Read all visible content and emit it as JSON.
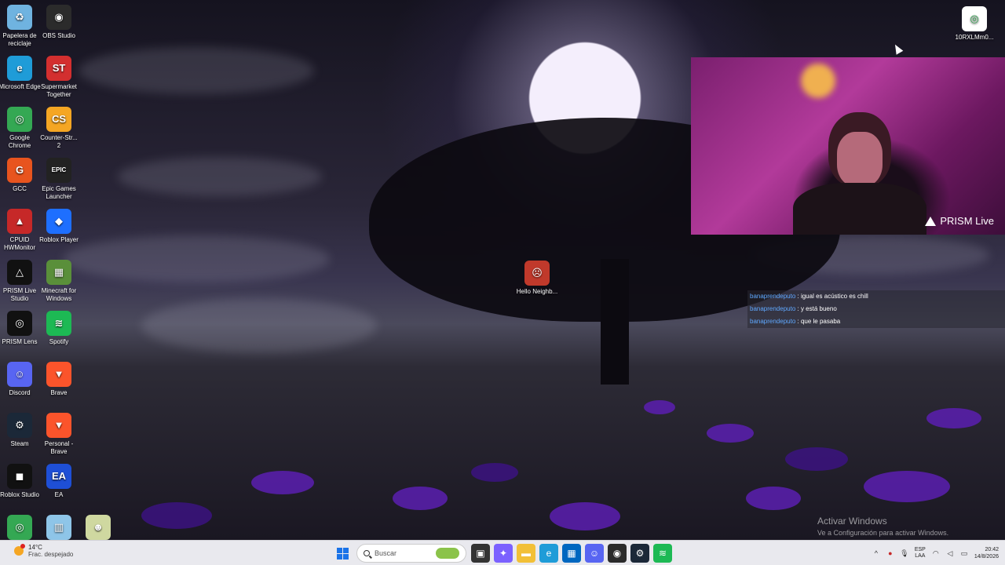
{
  "desktop_icons": [
    {
      "label": "Papelera de reciclaje",
      "icon": "recycle-bin-icon",
      "color": "#6fb3e0",
      "glyph": "♻"
    },
    {
      "label": "OBS Studio",
      "icon": "obs-icon",
      "color": "#2b2b2b",
      "glyph": "◉"
    },
    {
      "label": "Microsoft Edge",
      "icon": "edge-icon",
      "color": "#1f9cd8",
      "glyph": "e"
    },
    {
      "label": "Supermarket Together",
      "icon": "supermarket-together-icon",
      "color": "#d32f2f",
      "glyph": "ST"
    },
    {
      "label": "Google Chrome",
      "icon": "chrome-icon",
      "color": "#34a853",
      "glyph": "◎"
    },
    {
      "label": "Counter-Str... 2",
      "icon": "counter-strike-icon",
      "color": "#f5a623",
      "glyph": "CS"
    },
    {
      "label": "GCC",
      "icon": "gcc-icon",
      "color": "#e8541e",
      "glyph": "G"
    },
    {
      "label": "Epic Games Launcher",
      "icon": "epic-games-icon",
      "color": "#222222",
      "glyph": "EPIC"
    },
    {
      "label": "CPUID HWMonitor",
      "icon": "hwmonitor-icon",
      "color": "#c62828",
      "glyph": "▲"
    },
    {
      "label": "Roblox Player",
      "icon": "roblox-player-icon",
      "color": "#1e6fff",
      "glyph": "◆"
    },
    {
      "label": "PRISM Live Studio",
      "icon": "prism-live-icon",
      "color": "#111111",
      "glyph": "△"
    },
    {
      "label": "Minecraft for Windows",
      "icon": "minecraft-icon",
      "color": "#5a8f3a",
      "glyph": "▦"
    },
    {
      "label": "PRISM Lens",
      "icon": "prism-lens-icon",
      "color": "#111111",
      "glyph": "◎"
    },
    {
      "label": "Spotify",
      "icon": "spotify-icon",
      "color": "#1db954",
      "glyph": "≋"
    },
    {
      "label": "Discord",
      "icon": "discord-icon",
      "color": "#5865f2",
      "glyph": "☺"
    },
    {
      "label": "Brave",
      "icon": "brave-icon",
      "color": "#fb542b",
      "glyph": "▼"
    },
    {
      "label": "Steam",
      "icon": "steam-icon",
      "color": "#1b2838",
      "glyph": "⚙"
    },
    {
      "label": "Personal - Brave",
      "icon": "personal-brave-icon",
      "color": "#fb542b",
      "glyph": "▼"
    },
    {
      "label": "Roblox Studio",
      "icon": "roblox-studio-icon",
      "color": "#111111",
      "glyph": "◼"
    },
    {
      "label": "EA",
      "icon": "ea-icon",
      "color": "#1e4fd6",
      "glyph": "EA"
    },
    {
      "label": "",
      "icon": "chrome-icon",
      "color": "#34a853",
      "glyph": "◎"
    },
    {
      "label": "",
      "icon": "game-icon",
      "color": "#8ec5e8",
      "glyph": "▥"
    },
    {
      "label": "",
      "icon": "baldi-icon",
      "color": "#cfd8a0",
      "glyph": "☻"
    }
  ],
  "top_right_icon": {
    "label": "10RXLMm0...",
    "icon": "chrome-icon",
    "color": "#ffffff"
  },
  "center_icon": {
    "label": "Hello Neighb...",
    "icon": "hello-neighbor-icon",
    "color": "#c0392b"
  },
  "webcam": {
    "brand": "PRISM Live"
  },
  "chat": [
    {
      "user": "banaprendeputo",
      "message": " : igual es acústico es chill"
    },
    {
      "user": "banaprendeputo",
      "message": " : y está bueno"
    },
    {
      "user": "banaprendeputo",
      "message": " : que le pasaba"
    }
  ],
  "watermark": {
    "title": "Activar Windows",
    "subtitle": "Ve a Configuración para activar Windows."
  },
  "taskbar": {
    "weather_temp": "14°C",
    "weather_cond": "Frac. despejado",
    "search_placeholder": "Buscar",
    "pinned": [
      {
        "icon": "task-view-icon",
        "color": "#333333",
        "glyph": "▣"
      },
      {
        "icon": "copilot-icon",
        "color": "#7b61ff",
        "glyph": "✦"
      },
      {
        "icon": "file-explorer-icon",
        "color": "#f2c037",
        "glyph": "▬"
      },
      {
        "icon": "edge-icon",
        "color": "#1f9cd8",
        "glyph": "e"
      },
      {
        "icon": "store-icon",
        "color": "#0067c0",
        "glyph": "▦"
      },
      {
        "icon": "discord-icon",
        "color": "#5865f2",
        "glyph": "☺"
      },
      {
        "icon": "obs-icon",
        "color": "#2b2b2b",
        "glyph": "◉"
      },
      {
        "icon": "steam-icon",
        "color": "#1b2838",
        "glyph": "⚙"
      },
      {
        "icon": "spotify-icon",
        "color": "#1db954",
        "glyph": "≋"
      }
    ],
    "lang_top": "ESP",
    "lang_bottom": "LAA",
    "time": "20:42",
    "date": "14/8/2026"
  }
}
